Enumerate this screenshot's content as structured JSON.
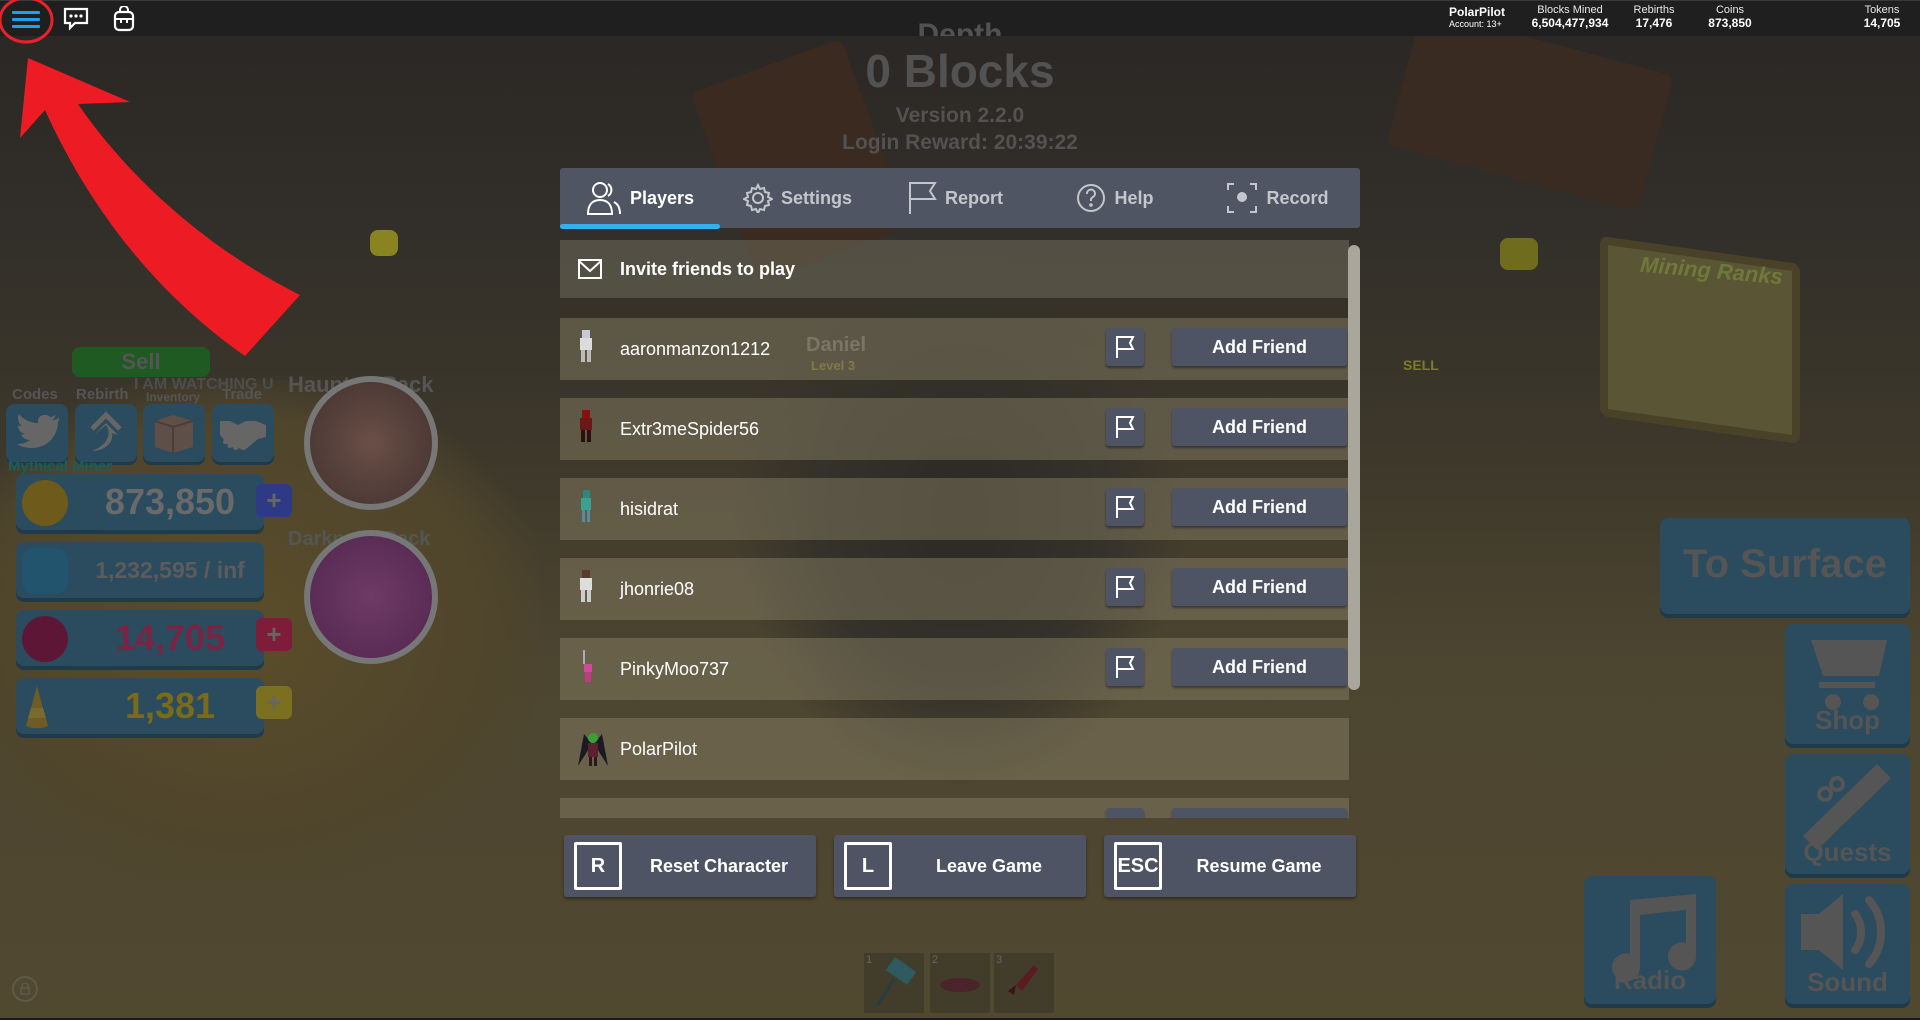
{
  "topbar": {
    "menu_icon": "hamburger-menu-icon",
    "chat_icon": "chat-icon",
    "backpack_icon": "backpack-icon",
    "account_name": "PolarPilot",
    "account_age": "Account: 13+",
    "stats": [
      {
        "label": "Blocks Mined",
        "value": "6,504,477,934"
      },
      {
        "label": "Rebirths",
        "value": "17,476"
      },
      {
        "label": "Coins",
        "value": "873,850"
      },
      {
        "label": "Tokens",
        "value": "14,705"
      }
    ]
  },
  "header": {
    "depth_label": "Depth",
    "blocks": "0 Blocks",
    "version": "Version 2.2.0",
    "login_reward": "Login Reward: 20:39:22"
  },
  "menu": {
    "tabs": [
      {
        "label": "Players",
        "icon": "players-icon",
        "active": true
      },
      {
        "label": "Settings",
        "icon": "gear-icon",
        "active": false
      },
      {
        "label": "Report",
        "icon": "flag-icon",
        "active": false
      },
      {
        "label": "Help",
        "icon": "help-icon",
        "active": false
      },
      {
        "label": "Record",
        "icon": "record-icon",
        "active": false
      }
    ],
    "invite_label": "Invite friends to play",
    "add_friend_label": "Add Friend",
    "players": [
      {
        "name": "aaronmanzon1212",
        "can_add": true
      },
      {
        "name": "Extr3meSpider56",
        "can_add": true
      },
      {
        "name": "hisidrat",
        "can_add": true
      },
      {
        "name": "jhonrie08",
        "can_add": true
      },
      {
        "name": "PinkyMoo737",
        "can_add": true
      },
      {
        "name": "PolarPilot",
        "can_add": false
      },
      {
        "name": "",
        "can_add": true
      }
    ],
    "buttons": [
      {
        "key": "R",
        "label": "Reset Character"
      },
      {
        "key": "L",
        "label": "Leave Game"
      },
      {
        "key": "ESC",
        "label": "Resume Game"
      }
    ]
  },
  "hud_left": {
    "sell_label": "Sell",
    "watching_text": "I AM WATCHING U",
    "mythical_text": "Mythical Miner",
    "shortcuts": [
      {
        "label": "Codes",
        "icon": "twitter-bird-icon"
      },
      {
        "label": "Rebirth",
        "icon": "rebirth-arrow-icon"
      },
      {
        "label": "Inventory",
        "icon": "crate-icon"
      },
      {
        "label": "Trade",
        "icon": "handshake-icon"
      }
    ],
    "currencies": [
      {
        "name": "coins",
        "value": "873,850",
        "color": "#d9a520",
        "has_plus": true,
        "plus_color": "#2e3a86",
        "text_color": "#6a6a6a"
      },
      {
        "name": "backpack",
        "value": "1,232,595 / inf",
        "color": "#2f86c0",
        "has_plus": false,
        "text_color": "#5c5c5c"
      },
      {
        "name": "tokens",
        "value": "14,705",
        "color": "#a01848",
        "has_plus": true,
        "plus_color": "#7e1c3a",
        "text_color": "#7a2443"
      },
      {
        "name": "candy",
        "value": "1,381",
        "color": "#c8a020",
        "has_plus": true,
        "plus_color": "#7a7020",
        "text_color": "#7a6a1a"
      }
    ],
    "packs": [
      {
        "title": "Haunted Pack"
      },
      {
        "title": "Darkness Pack"
      }
    ]
  },
  "hud_right": {
    "to_surface": "To Surface",
    "shop": "Shop",
    "quests": "Quests",
    "radio": "Radio",
    "sound": "Sound"
  },
  "hotbar": [
    {
      "slot": "1",
      "item": "hammer"
    },
    {
      "slot": "2",
      "item": "hoverboard"
    },
    {
      "slot": "3",
      "item": "rocket"
    }
  ],
  "world": {
    "npc_name": "Daniel",
    "npc_level": "Level 3",
    "board_title": "Mining Ranks",
    "sell_sign": "SELL"
  }
}
